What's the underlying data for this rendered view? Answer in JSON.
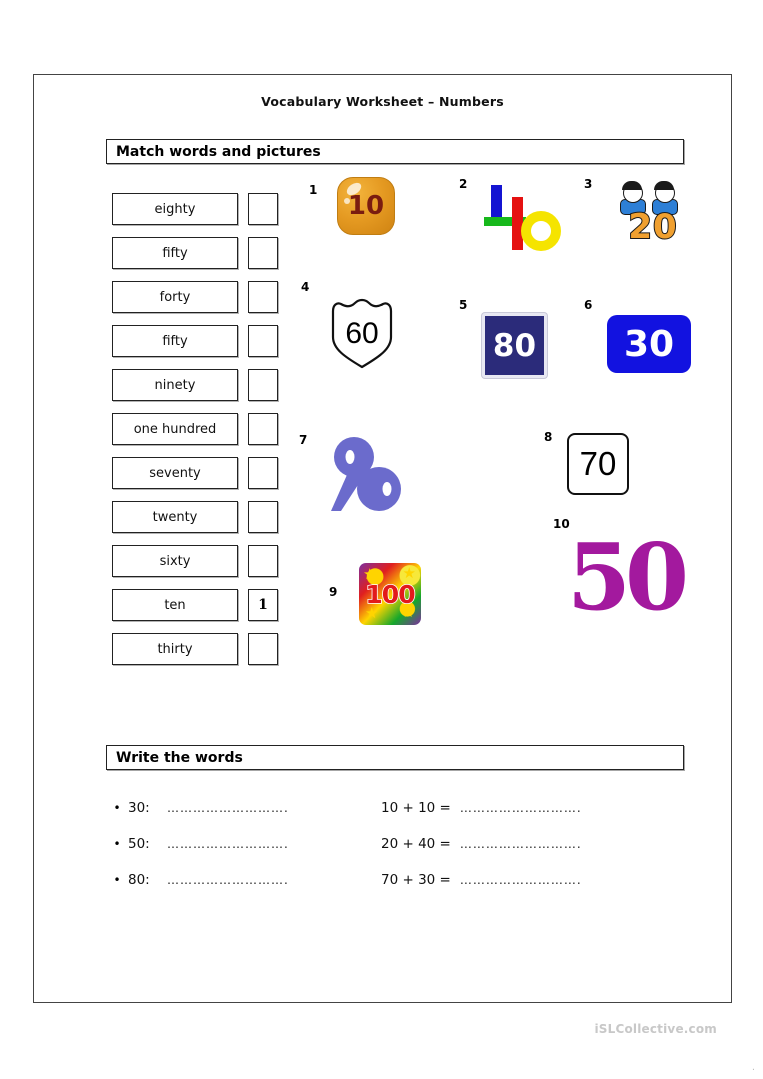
{
  "document": {
    "title": "Vocabulary Worksheet – Numbers",
    "footer_watermark": "iSLCollective.com",
    "footer_mark": "."
  },
  "sections": {
    "match": {
      "banner": "Match words and pictures",
      "words": [
        {
          "label": "eighty",
          "answer": ""
        },
        {
          "label": "fifty",
          "answer": ""
        },
        {
          "label": "forty",
          "answer": ""
        },
        {
          "label": "fifty",
          "answer": ""
        },
        {
          "label": "ninety",
          "answer": ""
        },
        {
          "label": "one hundred",
          "answer": ""
        },
        {
          "label": "seventy",
          "answer": ""
        },
        {
          "label": "twenty",
          "answer": ""
        },
        {
          "label": "sixty",
          "answer": ""
        },
        {
          "label": "ten",
          "answer": "1"
        },
        {
          "label": "thirty",
          "answer": ""
        }
      ],
      "pictures": [
        {
          "number": "1",
          "value": "10",
          "style": "glossy-orange-badge"
        },
        {
          "number": "2",
          "value": "40",
          "style": "colored-blocks"
        },
        {
          "number": "3",
          "value": "20",
          "style": "cartoon-kids-orange"
        },
        {
          "number": "4",
          "value": "60",
          "style": "highway-shield"
        },
        {
          "number": "5",
          "value": "80",
          "style": "navy-square-plate"
        },
        {
          "number": "6",
          "value": "30",
          "style": "blue-rounded-plate"
        },
        {
          "number": "7",
          "value": "90",
          "style": "abstract-purple"
        },
        {
          "number": "8",
          "value": "70",
          "style": "white-rounded-plate"
        },
        {
          "number": "9",
          "value": "100",
          "style": "party-sticker"
        },
        {
          "number": "10",
          "value": "50",
          "style": "big-purple-numeral"
        }
      ]
    },
    "write": {
      "banner": "Write the words",
      "bullet": "•",
      "dots": "……………………….",
      "rows": [
        {
          "left_label": "30:",
          "right_label": "10 + 10 ="
        },
        {
          "left_label": "50:",
          "right_label": "20 + 40 ="
        },
        {
          "left_label": "80:",
          "right_label": "70 + 30 ="
        }
      ]
    }
  },
  "colors": {
    "badge_orange": "#e59a22",
    "badge_orange_text": "#7a1c10",
    "block_blue": "#1414d2",
    "block_green": "#17b81c",
    "block_red": "#e51111",
    "block_yellow": "#f5e400",
    "kids_orange": "#f0a030",
    "navy_plate": "#2b2b7a",
    "bright_blue": "#1212e0",
    "abstract_purple": "#6b6bcc",
    "sticker_red": "#e21b1b",
    "big_purple": "#a3199e",
    "watermark_gray": "#c8c8c8"
  }
}
